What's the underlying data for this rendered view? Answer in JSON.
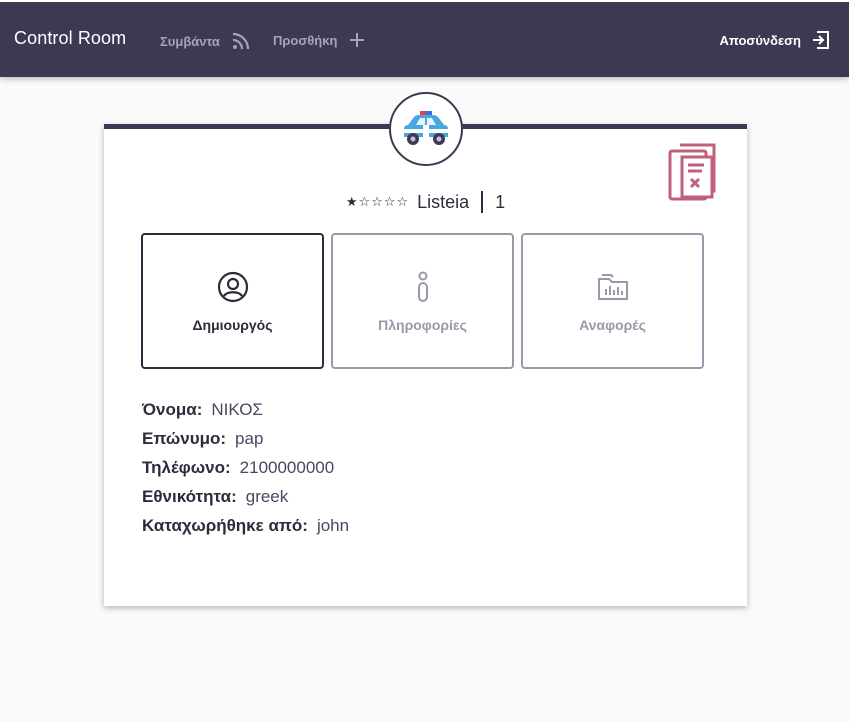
{
  "header": {
    "brand": "Control Room",
    "nav": [
      {
        "label": "Συμβάντα",
        "icon": "rss-icon"
      },
      {
        "label": "Προσθήκη",
        "icon": "plus-icon"
      }
    ],
    "logout_label": "Αποσύνδεση",
    "logout_icon": "logout-icon"
  },
  "card": {
    "avatar_icon": "police-car-icon",
    "corner_icon": "document-cancel-icon",
    "rating_stars": "★☆☆☆☆",
    "rating_value": 1,
    "rating_max": 5,
    "title": "Listeia",
    "count": "1",
    "tabs": [
      {
        "label": "Δημιουργός",
        "icon": "user-circle-icon",
        "active": true
      },
      {
        "label": "Πληροφορίες",
        "icon": "info-icon",
        "active": false
      },
      {
        "label": "Αναφορές",
        "icon": "reports-folder-icon",
        "active": false
      }
    ],
    "details": [
      {
        "key": "Όνομα:",
        "value": "ΝΙΚΟΣ"
      },
      {
        "key": "Επώνυμο:",
        "value": "pap"
      },
      {
        "key": "Τηλέφωνο:",
        "value": "2100000000"
      },
      {
        "key": "Εθνικότητα:",
        "value": "greek"
      },
      {
        "key": "Καταχωρήθηκε από:",
        "value": "john"
      }
    ]
  },
  "colors": {
    "header_bg": "#3c3a52",
    "text_dark": "#2e2c3c",
    "muted": "#9a98aa",
    "doc_icon": "#c0607a"
  }
}
